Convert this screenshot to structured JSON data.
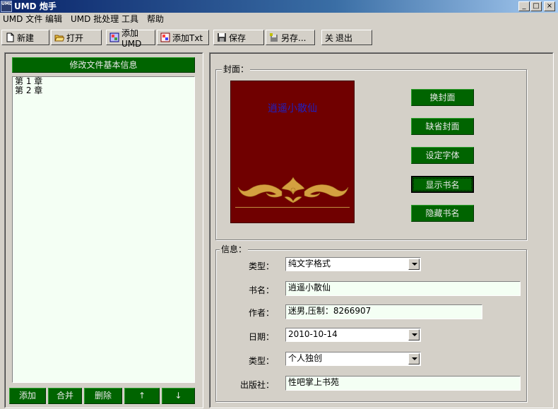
{
  "window": {
    "title": "UMD 炮手",
    "icon_label": "UMD"
  },
  "menu": [
    "UMD 文件",
    "编辑",
    "UMD 批处理",
    "工具",
    "帮助"
  ],
  "toolbar": {
    "new": "新建",
    "open": "打开",
    "add_umd": "添加UMD",
    "add_txt": "添加Txt",
    "save": "保存",
    "save_as": "另存...",
    "exit": "退出",
    "exit_icon_text": "关"
  },
  "left": {
    "edit_info_button": "修改文件基本信息",
    "chapters": [
      "第 1 章",
      "第 2 章"
    ],
    "buttons": {
      "add": "添加",
      "merge": "合并",
      "delete": "删除",
      "up": "↑",
      "down": "↓"
    }
  },
  "cover_group": {
    "label": "封面：",
    "cover_title": "逍遥小散仙",
    "buttons": {
      "change_cover": "换封面",
      "default_cover": "缺省封面",
      "set_font": "设定字体",
      "show_title": "显示书名",
      "hide_title": "隐藏书名"
    }
  },
  "info_group": {
    "label": "信息：",
    "type1": {
      "label": "类型：",
      "value": "纯文字格式"
    },
    "book_name": {
      "label": "书名：",
      "value": "逍遥小散仙"
    },
    "author": {
      "label": "作者：",
      "value": "迷男,压制：8266907"
    },
    "date": {
      "label": "日期：",
      "value": "2010-10-14"
    },
    "type2": {
      "label": "类型：",
      "value": "个人独创"
    },
    "publisher": {
      "label": "出版社：",
      "value": "性吧掌上书苑"
    }
  },
  "colors": {
    "green_button": "#006400",
    "cover_bg": "#700000",
    "field_bg": "#f4fff4",
    "chrome": "#d4d0c8"
  }
}
